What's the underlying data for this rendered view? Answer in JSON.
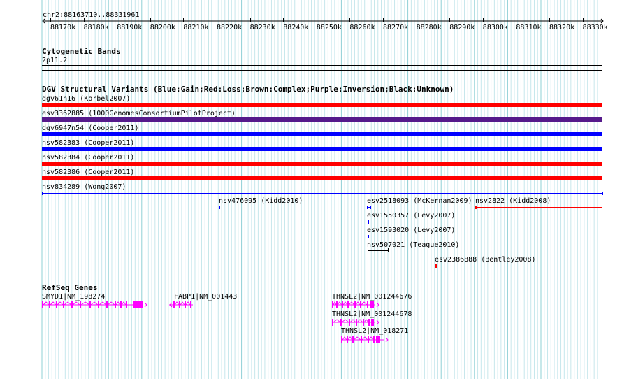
{
  "locus": "chr2:88163710..88331961",
  "ruler": {
    "ticks": [
      "88170k",
      "88180k",
      "88190k",
      "88200k",
      "88210k",
      "88220k",
      "88230k",
      "88240k",
      "88250k",
      "88260k",
      "88270k",
      "88280k",
      "88290k",
      "88300k",
      "88310k",
      "88320k",
      "88330k"
    ]
  },
  "cytoband": {
    "title": "Cytogenetic Bands",
    "band": "2p11.2"
  },
  "dgv": {
    "title": "DGV Structural Variants (Blue:Gain;Red:Loss;Brown:Complex;Purple:Inversion;Black:Unknown)",
    "colors": {
      "gain": "#0000ff",
      "loss": "#ff0000",
      "complex": "#8b4513",
      "inversion": "#551a8b",
      "unknown": "#000000"
    },
    "full_span": [
      {
        "label": "dgv61n16 (Korbel2007)",
        "type": "loss"
      },
      {
        "label": "esv3362885 (1000GenomesConsortiumPilotProject)",
        "type": "inversion"
      },
      {
        "label": "dgv6947n54 (Cooper2011)",
        "type": "gain"
      },
      {
        "label": "nsv582383 (Cooper2011)",
        "type": "gain"
      },
      {
        "label": "nsv582384 (Cooper2011)",
        "type": "loss"
      },
      {
        "label": "nsv582386 (Cooper2011)",
        "type": "loss"
      },
      {
        "label": "nsv834289 (Wong2007)",
        "type": "gain"
      }
    ],
    "partial": [
      {
        "label": "nsv476095 (Kidd2010)",
        "type": "gain"
      },
      {
        "label": "esv2518093 (McKernan2009)",
        "type": "gain"
      },
      {
        "label": "nsv2822 (Kidd2008)",
        "type": "loss"
      },
      {
        "label": "esv1550357 (Levy2007)",
        "type": "gain"
      },
      {
        "label": "esv1593020 (Levy2007)",
        "type": "gain"
      },
      {
        "label": "nsv507021 (Teague2010)",
        "type": "unknown"
      },
      {
        "label": "esv2386888 (Bentley2008)",
        "type": "loss"
      }
    ]
  },
  "refseq": {
    "title": "RefSeq Genes",
    "color": "#ff00ff",
    "genes": [
      {
        "label": "SMYD1|NM_198274"
      },
      {
        "label": "FABP1|NM_001443"
      },
      {
        "label": "THNSL2|NM_001244676"
      },
      {
        "label": "THNSL2|NM_001244678"
      },
      {
        "label": "THNSL2|NM_018271"
      }
    ]
  }
}
